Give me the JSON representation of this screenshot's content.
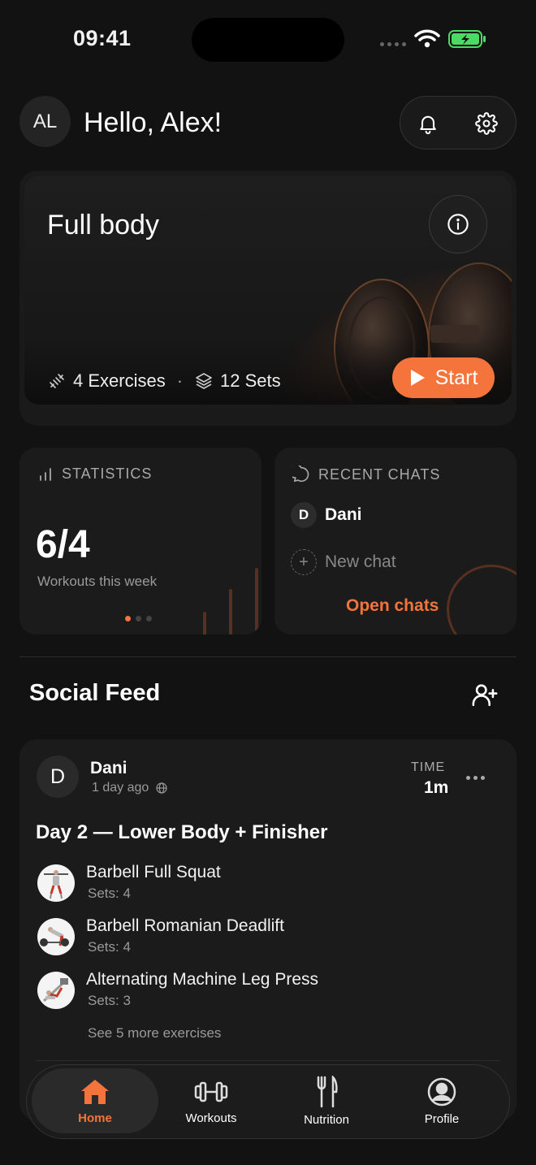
{
  "status_bar": {
    "time": "09:41"
  },
  "header": {
    "avatar_initials": "AL",
    "greeting": "Hello, Alex!"
  },
  "hero": {
    "title": "Full body",
    "exercises": "4 Exercises",
    "separator": "·",
    "sets": "12 Sets",
    "start_label": "Start"
  },
  "statistics": {
    "label": "STATISTICS",
    "value": "6/4",
    "caption": "Workouts this week",
    "pager_pages": 3,
    "pager_active": 0
  },
  "recent_chats": {
    "label": "RECENT CHATS",
    "chat_initial": "D",
    "chat_name": "Dani",
    "new_chat_label": "New chat",
    "open_label": "Open chats"
  },
  "social_feed": {
    "title": "Social Feed",
    "post": {
      "avatar_initial": "D",
      "author": "Dani",
      "when": "1 day ago",
      "time_label": "TIME",
      "time_value": "1m",
      "title": "Day 2 — Lower Body + Finisher",
      "exercises": [
        {
          "name": "Barbell Full Squat",
          "sets": "Sets: 4"
        },
        {
          "name": "Barbell Romanian Deadlift",
          "sets": "Sets: 4"
        },
        {
          "name": "Alternating Machine Leg Press",
          "sets": "Sets: 3"
        }
      ],
      "see_more": "See 5 more exercises"
    }
  },
  "tabbar": {
    "tabs": [
      {
        "label": "Home",
        "icon": "home-icon",
        "active": true
      },
      {
        "label": "Workouts",
        "icon": "dumbbell-icon",
        "active": false
      },
      {
        "label": "Nutrition",
        "icon": "fork-knife-icon",
        "active": false
      },
      {
        "label": "Profile",
        "icon": "profile-icon",
        "active": false
      }
    ]
  },
  "colors": {
    "accent": "#f4743b",
    "background": "#121212",
    "card": "#1b1b1b",
    "battery": "#4cd964"
  }
}
